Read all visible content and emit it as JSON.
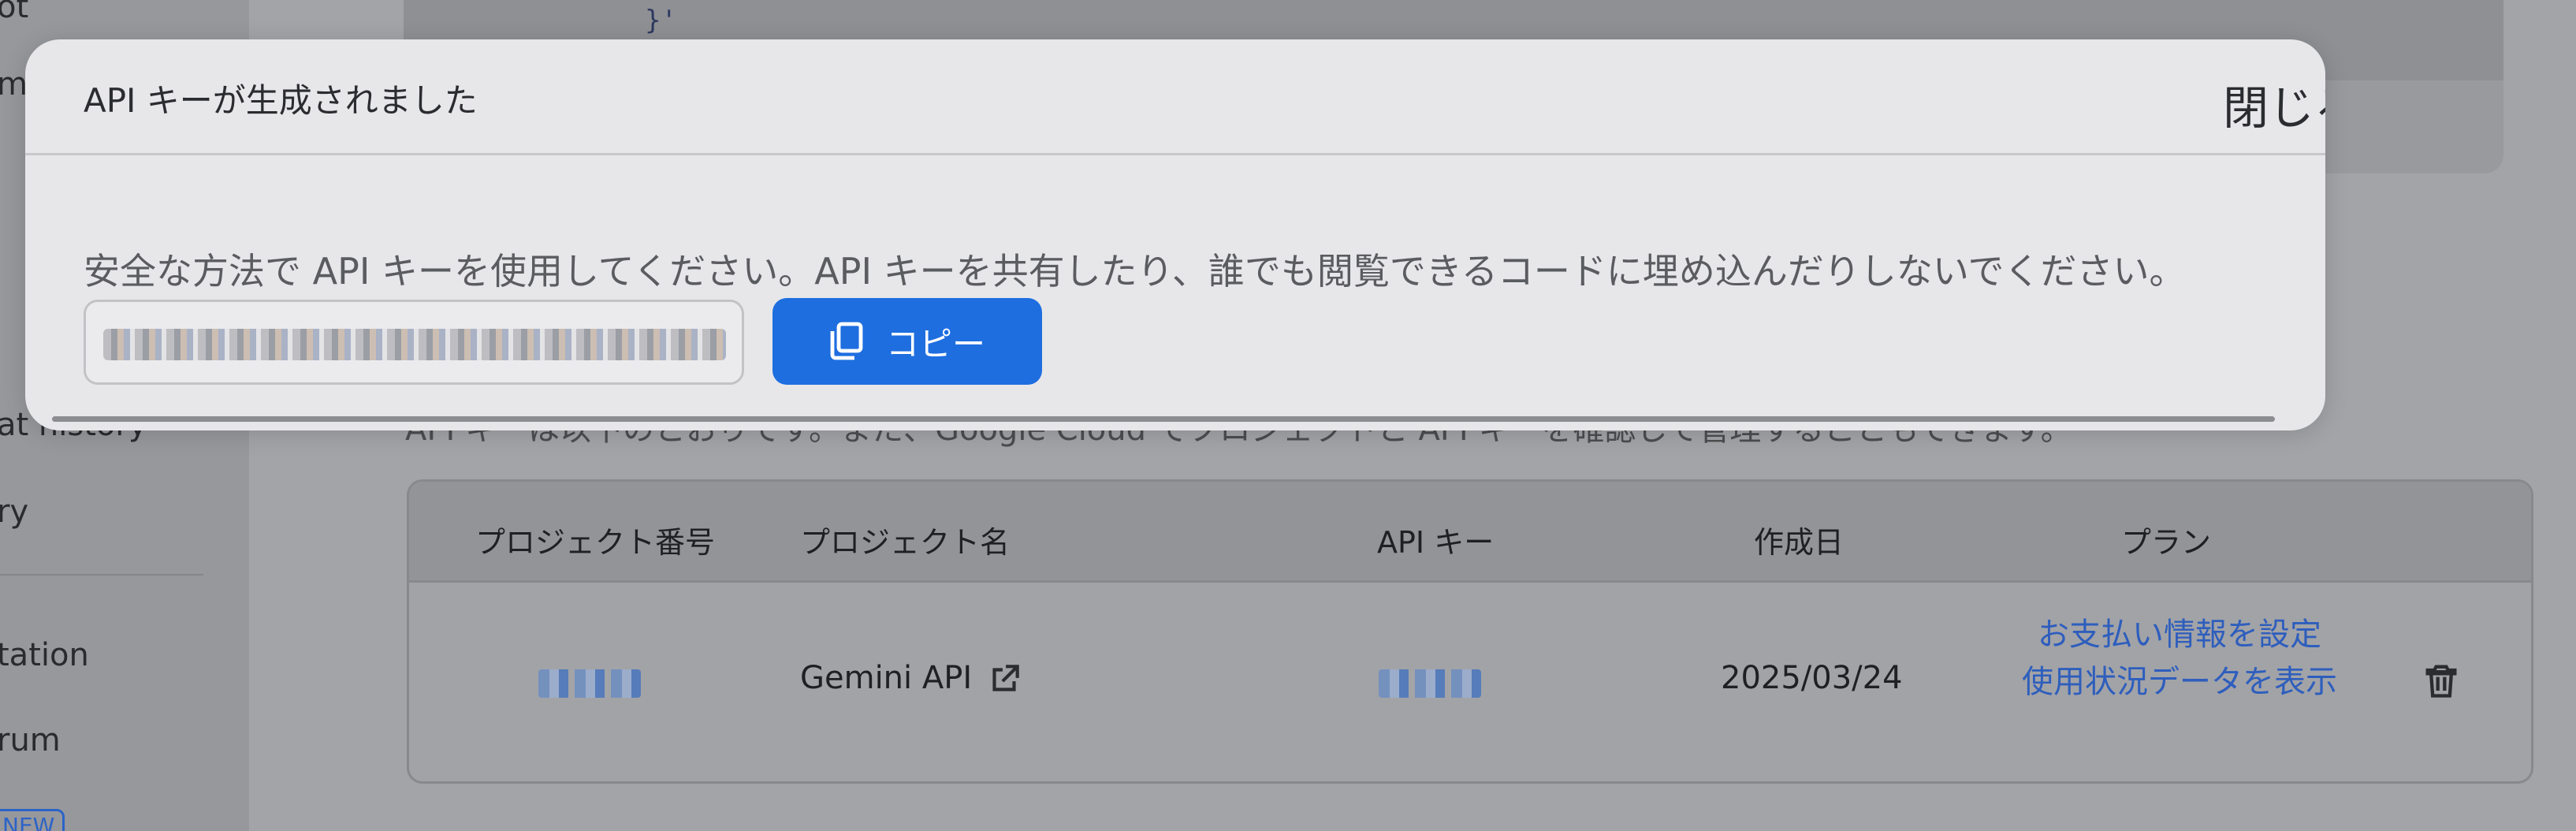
{
  "sidebar": {
    "items": [
      {
        "label": "ot"
      },
      {
        "label": "m"
      },
      {
        "label": "at history"
      },
      {
        "label": "ry"
      },
      {
        "label": "tation"
      },
      {
        "label": "rum"
      }
    ],
    "badge": "NEW"
  },
  "main": {
    "code_brace": "}'",
    "description": "API キーは以下のとおりです。また、Google Cloud でプロジェクトと API キーを確認して管理することもできます。",
    "table": {
      "headers": [
        "プロジェクト番号",
        "プロジェクト名",
        "API キー",
        "作成日",
        "プラン"
      ],
      "rows": [
        {
          "project_name": "Gemini API",
          "created": "2025/03/24",
          "plan_link_1": "お支払い情報を設定",
          "plan_link_2": "使用状況データを表示"
        }
      ]
    }
  },
  "modal": {
    "title": "API キーが生成されました",
    "close_label": "閉じる",
    "body": "安全な方法で API キーを使用してください。API キーを共有したり、誰でも閲覧できるコードに埋め込んだりしないでください。",
    "copy_label": "コピー"
  },
  "colors": {
    "accent": "#1e6ee0",
    "link": "#2e5ebd"
  }
}
